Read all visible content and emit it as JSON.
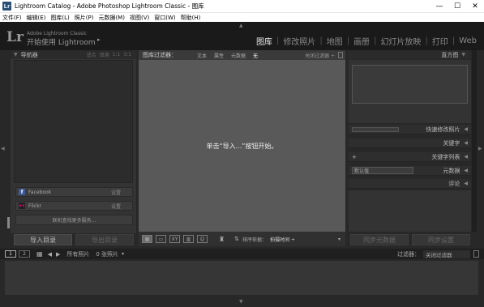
{
  "window": {
    "icon": "Lr",
    "title": "Lightroom Catalog - Adobe Photoshop Lightroom Classic - 图库",
    "minimize": "—",
    "maximize": "☐",
    "close": "✕"
  },
  "menu": [
    "文件(F)",
    "编辑(E)",
    "图库(L)",
    "照片(P)",
    "元数据(M)",
    "视图(V)",
    "窗口(W)",
    "帮助(H)"
  ],
  "identity": {
    "logo": "Lr",
    "subtitle": "Adobe Lightroom Classic",
    "main": "开始使用 Lightroom",
    "arrow": "▸"
  },
  "modules": [
    {
      "label": "图库",
      "active": true
    },
    {
      "label": "修改照片",
      "active": false
    },
    {
      "label": "地图",
      "active": false
    },
    {
      "label": "画册",
      "active": false
    },
    {
      "label": "幻灯片放映",
      "active": false
    },
    {
      "label": "打印",
      "active": false
    },
    {
      "label": "Web",
      "active": false
    }
  ],
  "left_panel": {
    "navigator_title": "导航器",
    "navigator_options": [
      "适合",
      "填满",
      "1:1",
      "3:1"
    ],
    "publish": [
      {
        "icon": "facebook-icon",
        "glyph": "f",
        "label": "Facebook",
        "action": "设置"
      },
      {
        "icon": "flickr-icon",
        "glyph": "••",
        "label": "Flickr",
        "action": "设置"
      }
    ],
    "find_more": "联机查找更多服务...",
    "import_button": "导入目录",
    "export_button": "导出目录"
  },
  "center": {
    "filter_title": "图库过滤器：",
    "filter_options": [
      "文本",
      "属性",
      "元数据",
      "无"
    ],
    "filter_active": "无",
    "filter_preset": "关闭过滤器 ÷",
    "empty_message": "单击“导入...”按钮开始。",
    "sort_label": "排序依据：",
    "sort_value": "拍摄时间 ÷"
  },
  "right_panel": {
    "histogram_title": "直方图",
    "quick_develop": "快速修改照片",
    "keywords": "关键字",
    "keyword_list": "关键字列表",
    "metadata": "元数据",
    "metadata_preset": "默认值",
    "comments": "评论",
    "sync_metadata": "同步元数据",
    "sync_settings": "同步设置"
  },
  "filmstrip": {
    "page1": "1",
    "page2": "2",
    "source": "所有照片",
    "count": "0 张照片",
    "filter_label": "过滤器：",
    "filter_value": "关闭过滤器"
  },
  "colors": {
    "accent": "#e8e8e8",
    "background": "#282828",
    "grid": "#595959"
  }
}
